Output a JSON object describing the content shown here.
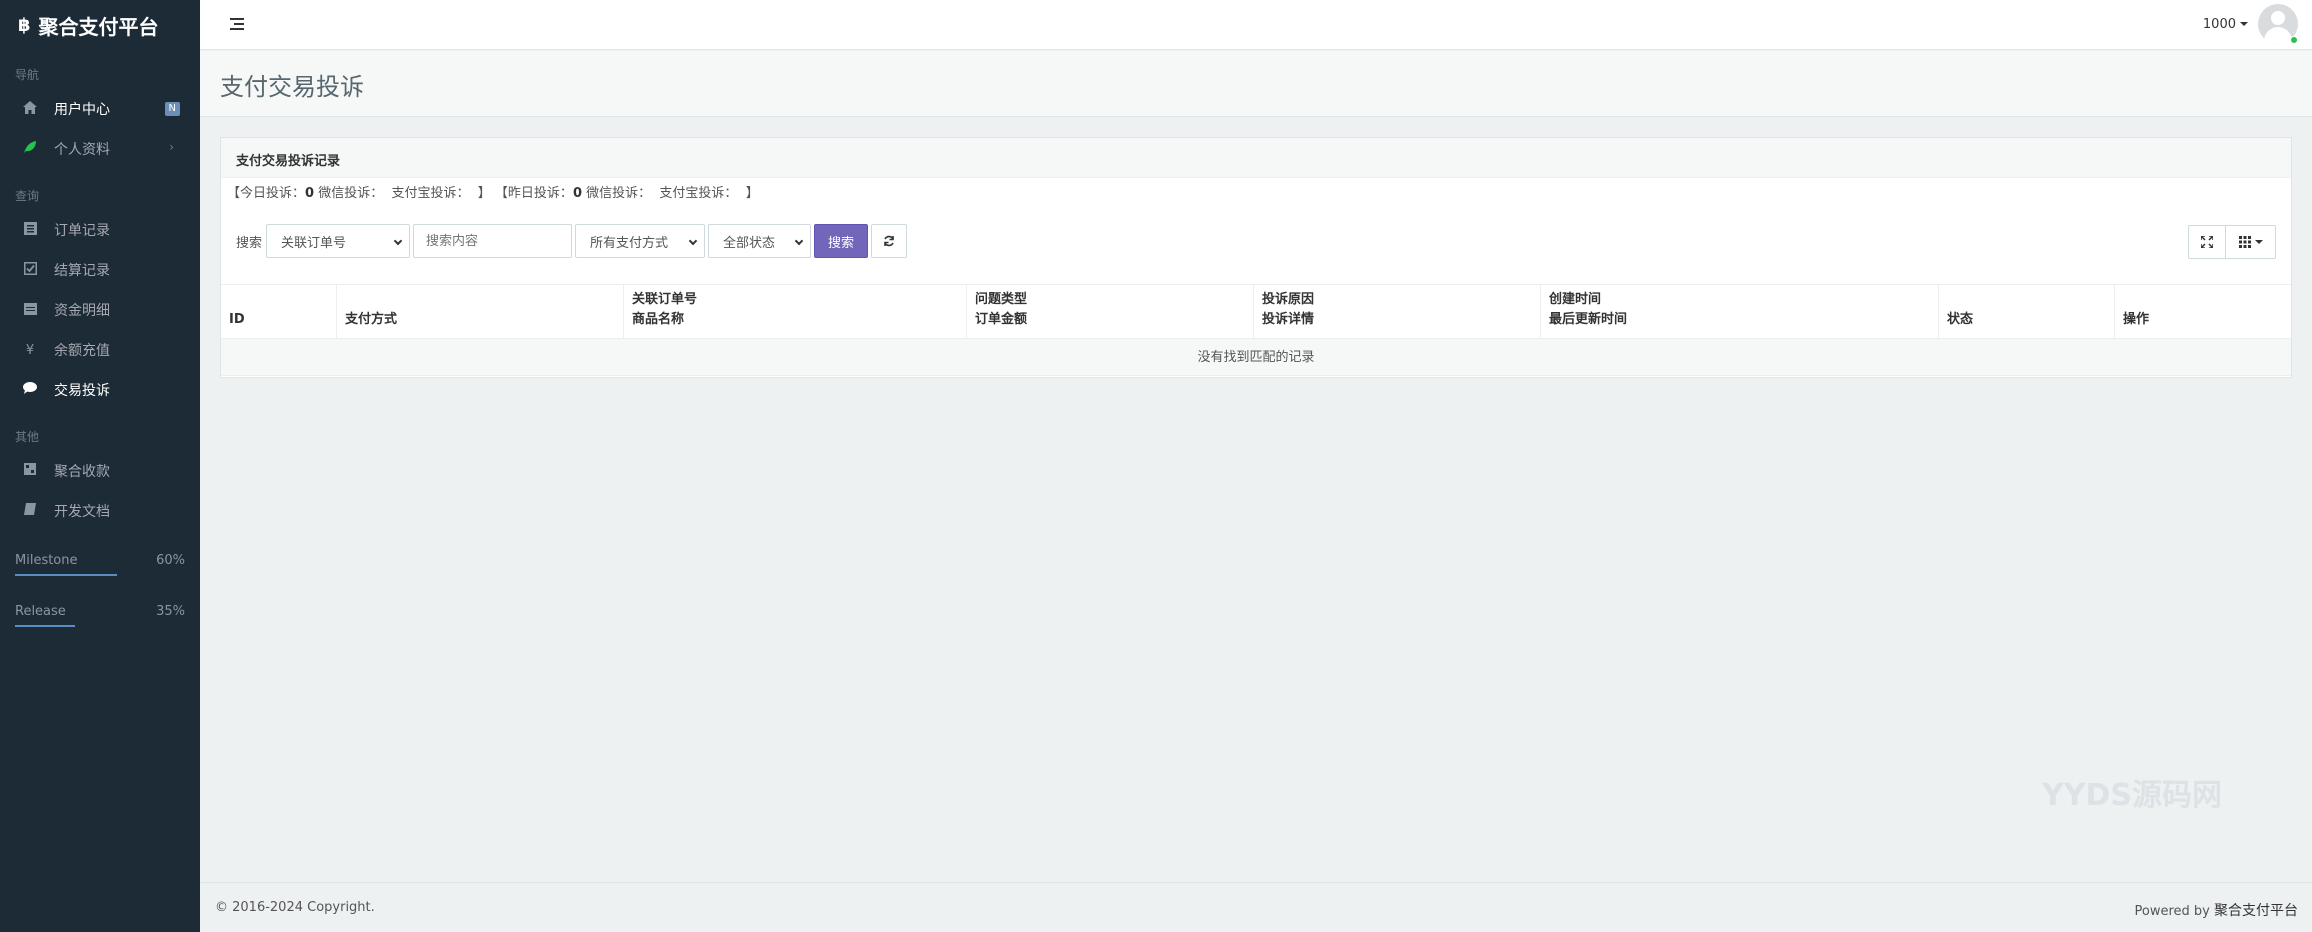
{
  "brand": {
    "logo": "฿",
    "name": "聚合支付平台"
  },
  "sidebar": {
    "sections": [
      {
        "heading": "导航",
        "items": [
          {
            "label": "用户中心",
            "icon": "home-icon",
            "badge": "N"
          },
          {
            "label": "个人资料",
            "icon": "leaf-icon",
            "chevron": "›"
          }
        ]
      },
      {
        "heading": "查询",
        "items": [
          {
            "label": "订单记录",
            "icon": "list-icon"
          },
          {
            "label": "结算记录",
            "icon": "check-square-icon"
          },
          {
            "label": "资金明细",
            "icon": "calendar-icon"
          },
          {
            "label": "余额充值",
            "icon": "yen-icon"
          },
          {
            "label": "交易投诉",
            "icon": "comment-icon"
          }
        ]
      },
      {
        "heading": "其他",
        "items": [
          {
            "label": "聚合收款",
            "icon": "qrcode-icon"
          },
          {
            "label": "开发文档",
            "icon": "book-icon"
          }
        ]
      }
    ],
    "progress": [
      {
        "label": "Milestone",
        "value": "60%",
        "fraction": 0.6
      },
      {
        "label": "Release",
        "value": "35%",
        "fraction": 0.35
      }
    ]
  },
  "header": {
    "user": "1000"
  },
  "page": {
    "title": "支付交易投诉"
  },
  "panel": {
    "title": "支付交易投诉记录",
    "stats": {
      "open1": "【今日投诉：",
      "today_count": "0",
      "wx1": "微信投诉：",
      "ali1": "支付宝投诉：",
      "close1": "】",
      "open2": "【昨日投诉：",
      "yesterday_count": "0",
      "wx2": "微信投诉：",
      "ali2": "支付宝投诉：",
      "close2": "】"
    },
    "search": {
      "label": "搜索",
      "field_select": "关联订单号",
      "placeholder": "搜索内容",
      "pay_select": "所有支付方式",
      "status_select": "全部状态",
      "button": "搜索"
    },
    "columns": [
      {
        "line1": "",
        "line2": "ID"
      },
      {
        "line1": "",
        "line2": "支付方式"
      },
      {
        "line1": "关联订单号",
        "line2": "商品名称"
      },
      {
        "line1": "问题类型",
        "line2": "订单金额"
      },
      {
        "line1": "投诉原因",
        "line2": "投诉详情"
      },
      {
        "line1": "创建时间",
        "line2": "最后更新时间"
      },
      {
        "line1": "",
        "line2": "状态"
      },
      {
        "line1": "",
        "line2": "操作"
      }
    ],
    "empty": "没有找到匹配的记录"
  },
  "watermark": "YYDS源码网",
  "footer": {
    "copyright": "© 2016-2024 Copyright.",
    "powered_prefix": "Powered by ",
    "powered_name": "聚合支付平台"
  }
}
